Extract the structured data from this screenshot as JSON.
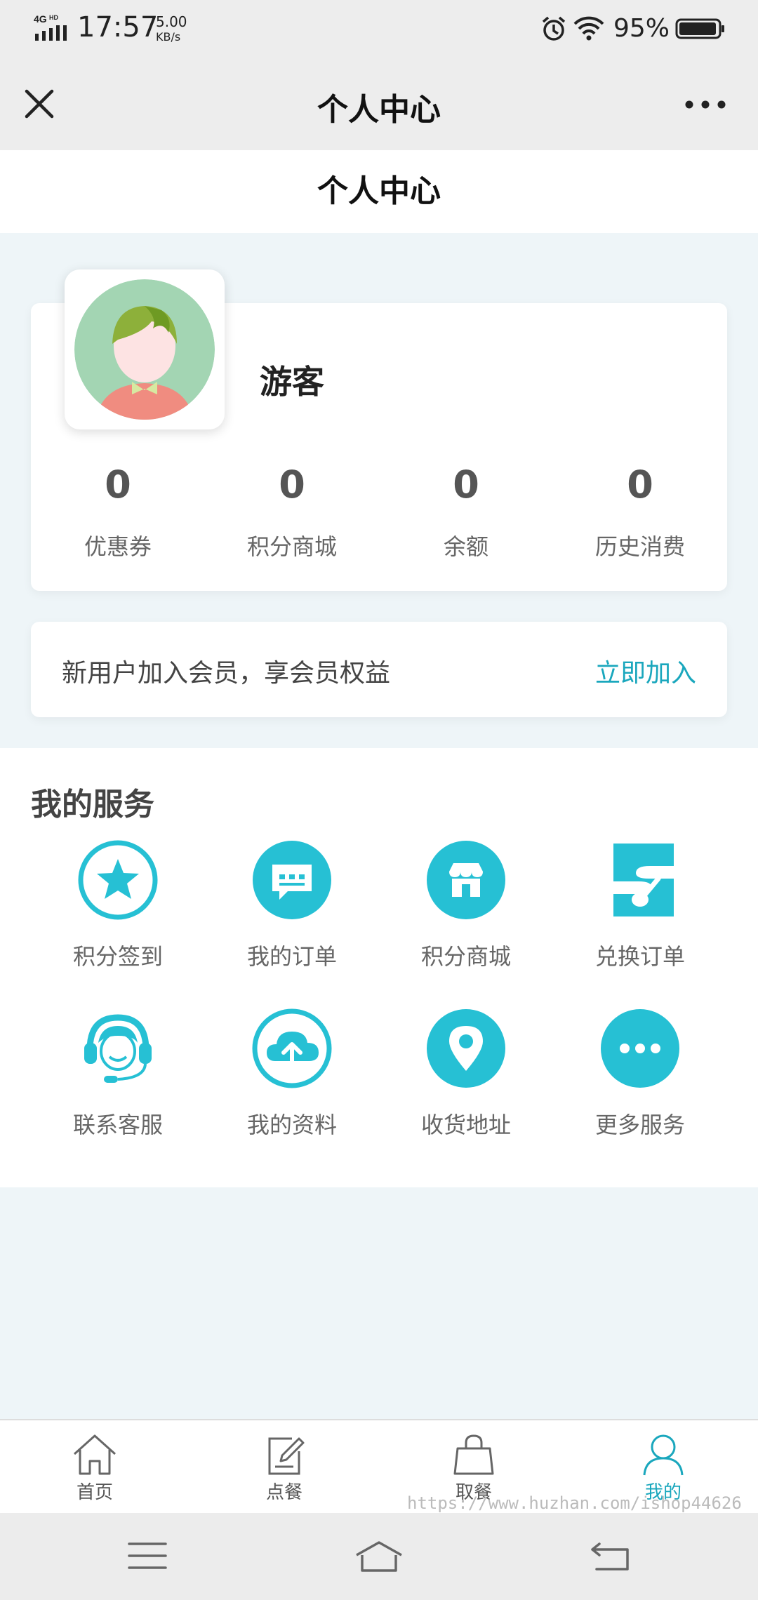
{
  "status_bar": {
    "network": "4G HD",
    "time": "17:57",
    "speed_value": "5.00",
    "speed_unit": "KB/s",
    "battery": "95%"
  },
  "title_bar": {
    "title": "个人中心",
    "close_icon": "close-icon",
    "more_icon": "more-icon"
  },
  "page_header": {
    "title": "个人中心"
  },
  "profile": {
    "username": "游客",
    "stats": [
      {
        "value": "0",
        "label": "优惠券"
      },
      {
        "value": "0",
        "label": "积分商城"
      },
      {
        "value": "0",
        "label": "余额"
      },
      {
        "value": "0",
        "label": "历史消费"
      }
    ]
  },
  "member_banner": {
    "text": "新用户加入会员，享会员权益",
    "action": "立即加入"
  },
  "services": {
    "title": "我的服务",
    "items": [
      {
        "label": "积分签到",
        "icon": "star-icon"
      },
      {
        "label": "我的订单",
        "icon": "chat-icon"
      },
      {
        "label": "积分商城",
        "icon": "shop-icon"
      },
      {
        "label": "兑换订单",
        "icon": "spoon-icon"
      },
      {
        "label": "联系客服",
        "icon": "headset-icon"
      },
      {
        "label": "我的资料",
        "icon": "cloud-upload-icon"
      },
      {
        "label": "收货地址",
        "icon": "location-icon"
      },
      {
        "label": "更多服务",
        "icon": "more-dots-icon"
      }
    ]
  },
  "tab_bar": {
    "tabs": [
      {
        "label": "首页",
        "icon": "home-icon"
      },
      {
        "label": "点餐",
        "icon": "edit-icon"
      },
      {
        "label": "取餐",
        "icon": "bag-icon"
      },
      {
        "label": "我的",
        "icon": "user-icon",
        "active": true
      }
    ]
  },
  "watermark": "https://www.huzhan.com/ishop44626",
  "colors": {
    "accent": "#26c0d4",
    "accent_text": "#1aa7bd",
    "background": "#eef5f8"
  }
}
